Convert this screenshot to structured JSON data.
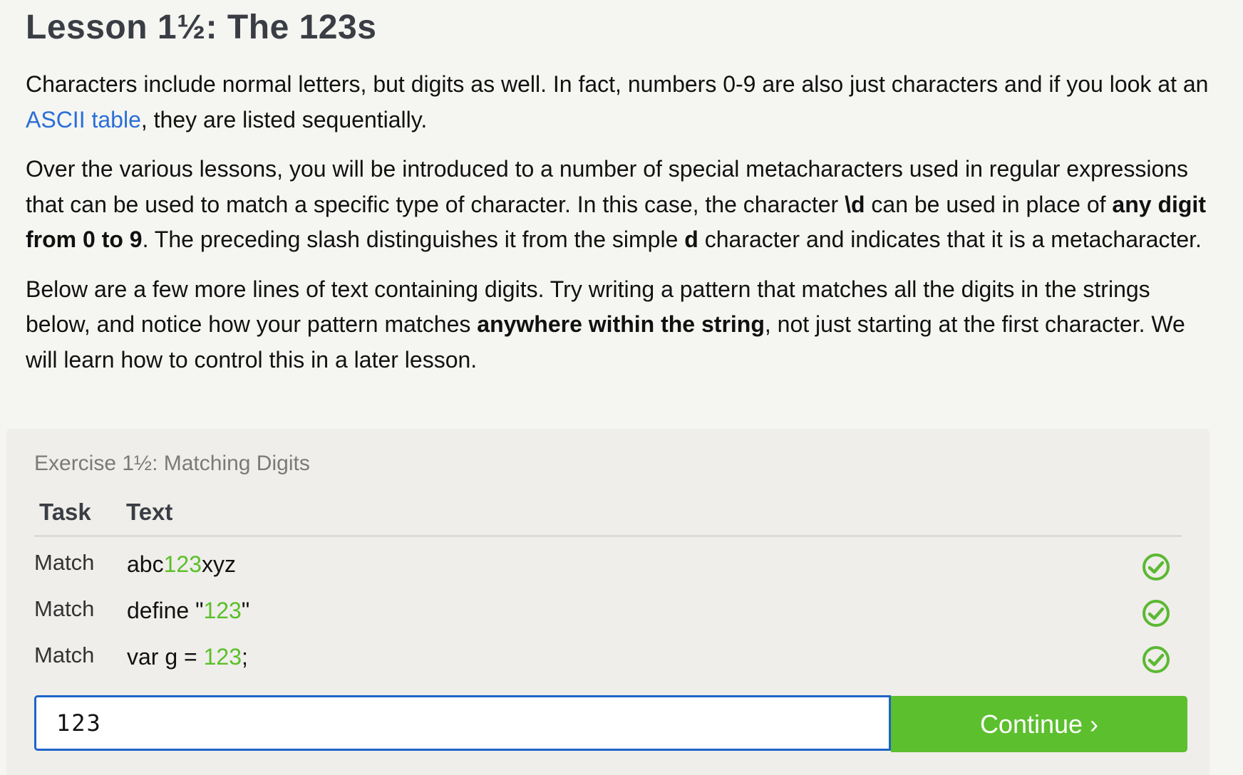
{
  "lesson": {
    "title": "Lesson 1½: The 123s",
    "p1": {
      "before_link": "Characters include normal letters, but digits as well. In fact, numbers 0-9 are also just characters and if you look at an ",
      "link": "ASCII table",
      "after_link": ", they are listed sequentially."
    },
    "p2": {
      "part1": "Over the various lessons, you will be introduced to a number of special metacharacters used in regular expressions that can be used to match a specific type of character. In this case, the character ",
      "bold1": "\\d",
      "part2": " can be used in place of ",
      "bold2": "any digit from 0 to 9",
      "part3": ". The preceding slash distinguishes it from the simple ",
      "bold3": "d",
      "part4": " character and indicates that it is a metacharacter."
    },
    "p3": {
      "part1": "Below are a few more lines of text containing digits. Try writing a pattern that matches all the digits in the strings below, and notice how your pattern matches ",
      "bold1": "anywhere within the string",
      "part2": ", not just starting at the first character. We will learn how to control this in a later lesson."
    }
  },
  "exercise": {
    "title": "Exercise 1½: Matching Digits",
    "headers": {
      "task": "Task",
      "text": "Text"
    },
    "rows": [
      {
        "task": "Match",
        "pre": "abc",
        "match": "123",
        "post": "xyz",
        "status": "matched"
      },
      {
        "task": "Match",
        "pre": "define \"",
        "match": "123",
        "post": "\"",
        "status": "matched"
      },
      {
        "task": "Match",
        "pre": "var g = ",
        "match": "123",
        "post": ";",
        "status": "matched"
      }
    ],
    "input_value": "123",
    "continue_label": "Continue ›"
  },
  "colors": {
    "link": "#2a6fd6",
    "match_highlight": "#5bbf2a",
    "check_icon": "#5cb833",
    "continue_button": "#5cbf2e",
    "input_border": "#1e64c8"
  },
  "icons": {
    "row_status": "check-circle-icon"
  }
}
